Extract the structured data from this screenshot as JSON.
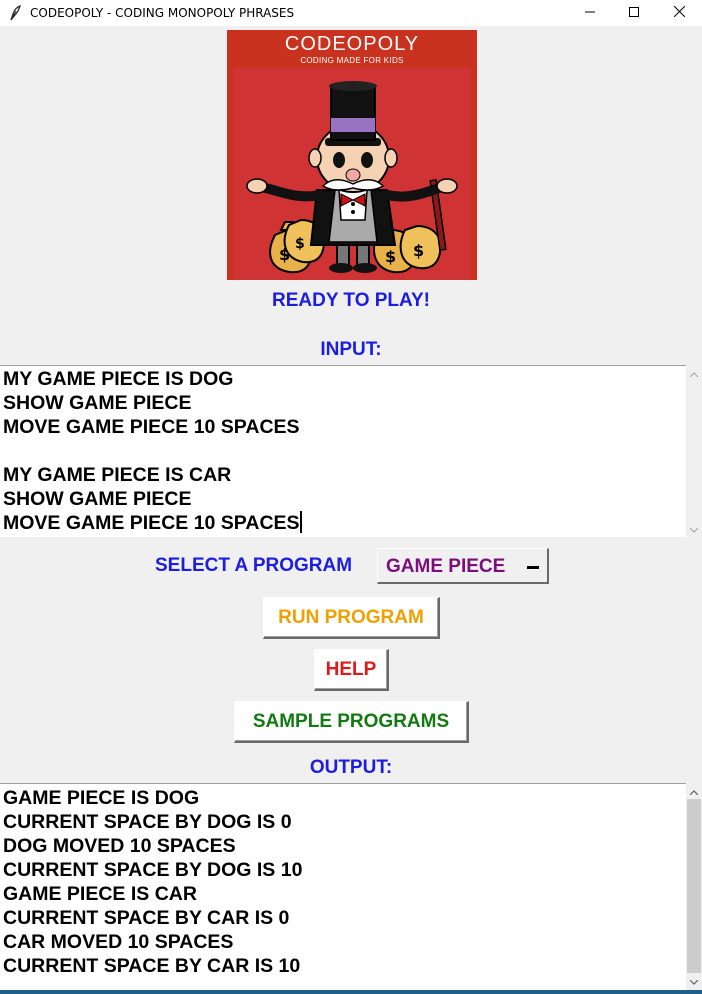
{
  "window": {
    "title": "CODEOPOLY - CODING MONOPOLY PHRASES",
    "icon": "feather-icon",
    "controls": [
      "minimize-icon",
      "maximize-icon",
      "close-icon"
    ]
  },
  "logo": {
    "title": "CODEOPOLY",
    "subtitle": "CODING MADE FOR KIDS"
  },
  "status": "READY TO PLAY!",
  "input": {
    "label": "INPUT:",
    "lines": [
      "MY GAME PIECE IS DOG",
      "SHOW GAME PIECE",
      "MOVE GAME PIECE 10 SPACES",
      "",
      "MY GAME PIECE IS CAR",
      "SHOW GAME PIECE",
      "MOVE GAME PIECE 10 SPACES"
    ]
  },
  "program_select": {
    "label": "SELECT A PROGRAM",
    "selected": "GAME PIECE"
  },
  "buttons": {
    "run": "RUN PROGRAM",
    "help": "HELP",
    "samples": "SAMPLE PROGRAMS"
  },
  "output": {
    "label": "OUTPUT:",
    "lines": [
      "GAME PIECE IS DOG",
      "CURRENT SPACE BY DOG IS 0",
      "DOG MOVED 10 SPACES",
      "CURRENT SPACE BY DOG IS 10",
      "GAME PIECE IS CAR",
      "CURRENT SPACE BY CAR IS 0",
      "CAR MOVED 10 SPACES",
      "CURRENT SPACE BY CAR IS 10"
    ]
  },
  "colors": {
    "label_blue": "#1d1de0",
    "select_purple": "#7b0e7b",
    "run_orange": "#f0a000",
    "help_red": "#e01a1a",
    "sample_green": "#117a11",
    "logo_red": "#c8321e"
  }
}
